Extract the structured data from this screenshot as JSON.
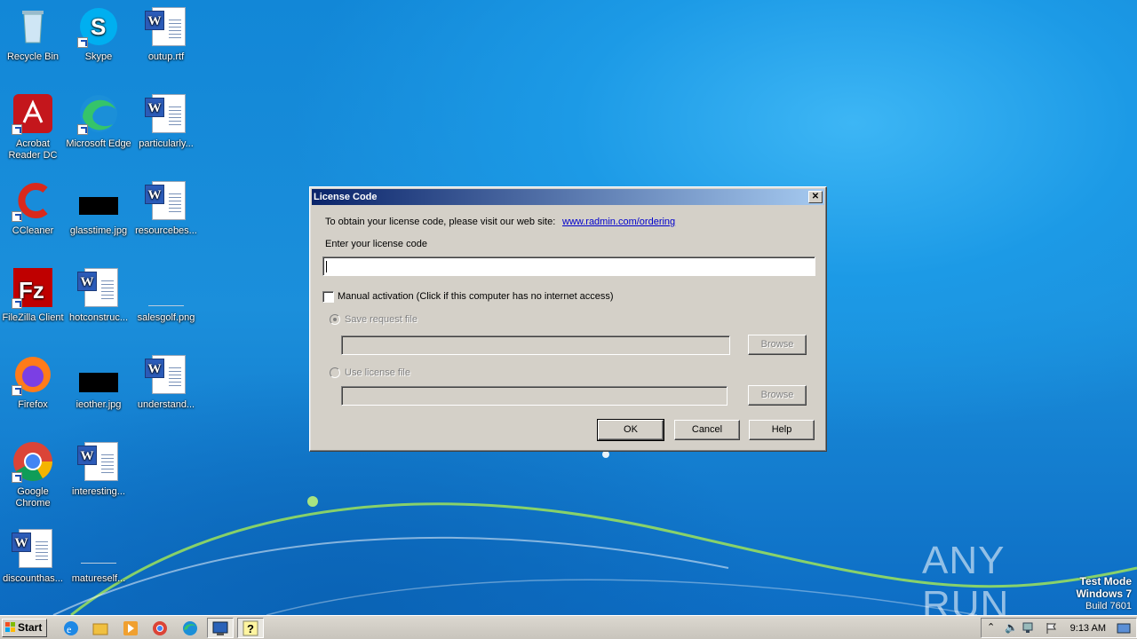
{
  "desktop": {
    "icons": [
      {
        "label": "Recycle Bin"
      },
      {
        "label": "Skype"
      },
      {
        "label": "outup.rtf"
      },
      {
        "label": "Acrobat Reader DC"
      },
      {
        "label": "Microsoft Edge"
      },
      {
        "label": "particularly..."
      },
      {
        "label": "CCleaner"
      },
      {
        "label": "glasstime.jpg"
      },
      {
        "label": "resourcebes..."
      },
      {
        "label": "FileZilla Client"
      },
      {
        "label": "hotconstruc..."
      },
      {
        "label": "salesgolf.png"
      },
      {
        "label": "Firefox"
      },
      {
        "label": "ieother.jpg"
      },
      {
        "label": "understand..."
      },
      {
        "label": "Google Chrome"
      },
      {
        "label": "interesting..."
      },
      {
        "label": "discounthas..."
      },
      {
        "label": "matureself..."
      }
    ]
  },
  "dialog": {
    "title": "License Code",
    "close_glyph": "✕",
    "info_text": "To obtain your license code, please visit our web site:",
    "link_text": "www.radmin.com/ordering",
    "enter_label": "Enter your license code",
    "license_value": "",
    "manual_activation_label": "Manual activation (Click if this computer has no internet access)",
    "manual_activation_checked": false,
    "save_request_label": "Save request file",
    "use_license_label": "Use license file",
    "browse_label": "Browse",
    "ok_label": "OK",
    "cancel_label": "Cancel",
    "help_label": "Help"
  },
  "taskbar": {
    "start_label": "Start",
    "clock": "9:13 AM"
  },
  "watermark": {
    "text": "ANY RUN",
    "test_mode": "Test Mode",
    "os": "Windows 7",
    "build": "Build 7601"
  },
  "colors": {
    "titlebar_start": "#0a246a",
    "titlebar_end": "#a6caf0",
    "dialog_face": "#d4d0c8",
    "link": "#0000cc"
  }
}
